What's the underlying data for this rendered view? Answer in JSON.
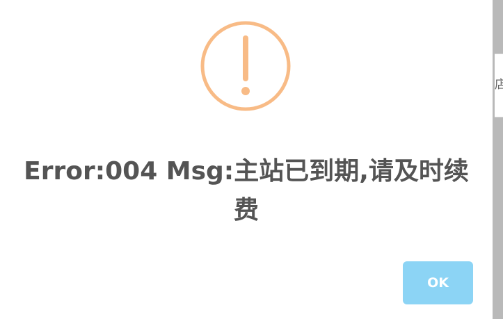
{
  "dialog": {
    "icon": "warning-exclamation-icon",
    "icon_color": "#f8bb86",
    "message": "Error:004 Msg:主站已到期,请及时续费",
    "confirm_label": "OK",
    "confirm_color": "#8cd4f5",
    "text_color": "#545454"
  },
  "backdrop": {
    "partial_text": "店"
  }
}
